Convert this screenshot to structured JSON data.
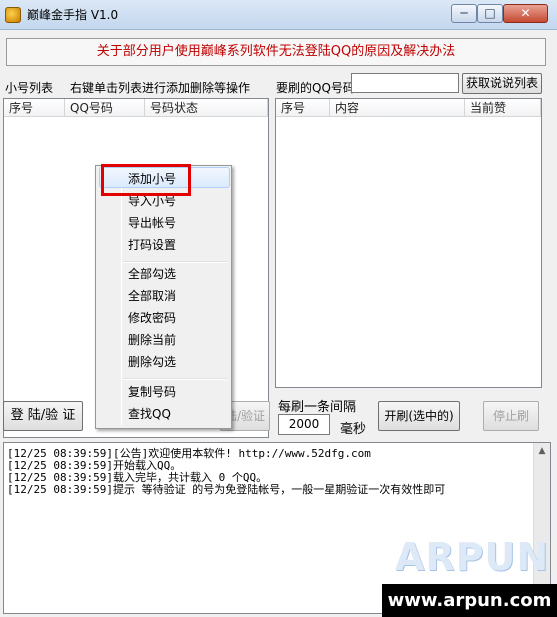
{
  "window": {
    "title": "巅峰金手指 V1.0",
    "min_glyph": "─",
    "max_glyph": "□",
    "close_glyph": "✕"
  },
  "notice": "关于部分用户使用巅峰系列软件无法登陆QQ的原因及解决办法",
  "left_panel": {
    "label": "小号列表",
    "hint": "右键单击列表进行添加删除等操作",
    "columns": [
      "序号",
      "QQ号码",
      "号码状态"
    ]
  },
  "right_panel": {
    "label": "要刷的QQ号码",
    "qq_value": "",
    "fetch_button": "获取说说列表",
    "columns": [
      "序号",
      "内容",
      "当前赞"
    ]
  },
  "context_menu": {
    "items": [
      "添加小号",
      "导入小号",
      "导出帐号",
      "打码设置",
      "全部勾选",
      "全部取消",
      "修改密码",
      "删除当前",
      "删除勾选",
      "复制号码",
      "查找QQ"
    ]
  },
  "controls": {
    "login_button": "登 陆/验 证",
    "hidden_button": "陆/验证",
    "interval_label": "每刷一条间隔",
    "interval_value": "2000",
    "interval_unit": "毫秒",
    "start_button": "开刷(选中的)",
    "stop_button": "停止刷"
  },
  "log": [
    "[12/25 08:39:59][公告]欢迎使用本软件!  http://www.52dfg.com",
    "[12/25 08:39:59]开始载入QQ。",
    "[12/25 08:39:59]载入完毕，共计载入 0 个QQ。",
    "[12/25 08:39:59]提示 等待验证 的号为免登陆帐号，一般一星期验证一次有效性即可"
  ],
  "watermark": {
    "logo": "ARPUN",
    "url": "www.arpun.com"
  },
  "colors": {
    "notice_text": "#c00000",
    "highlight_box": "#e50000",
    "titlebar": "#c4d7ee"
  }
}
